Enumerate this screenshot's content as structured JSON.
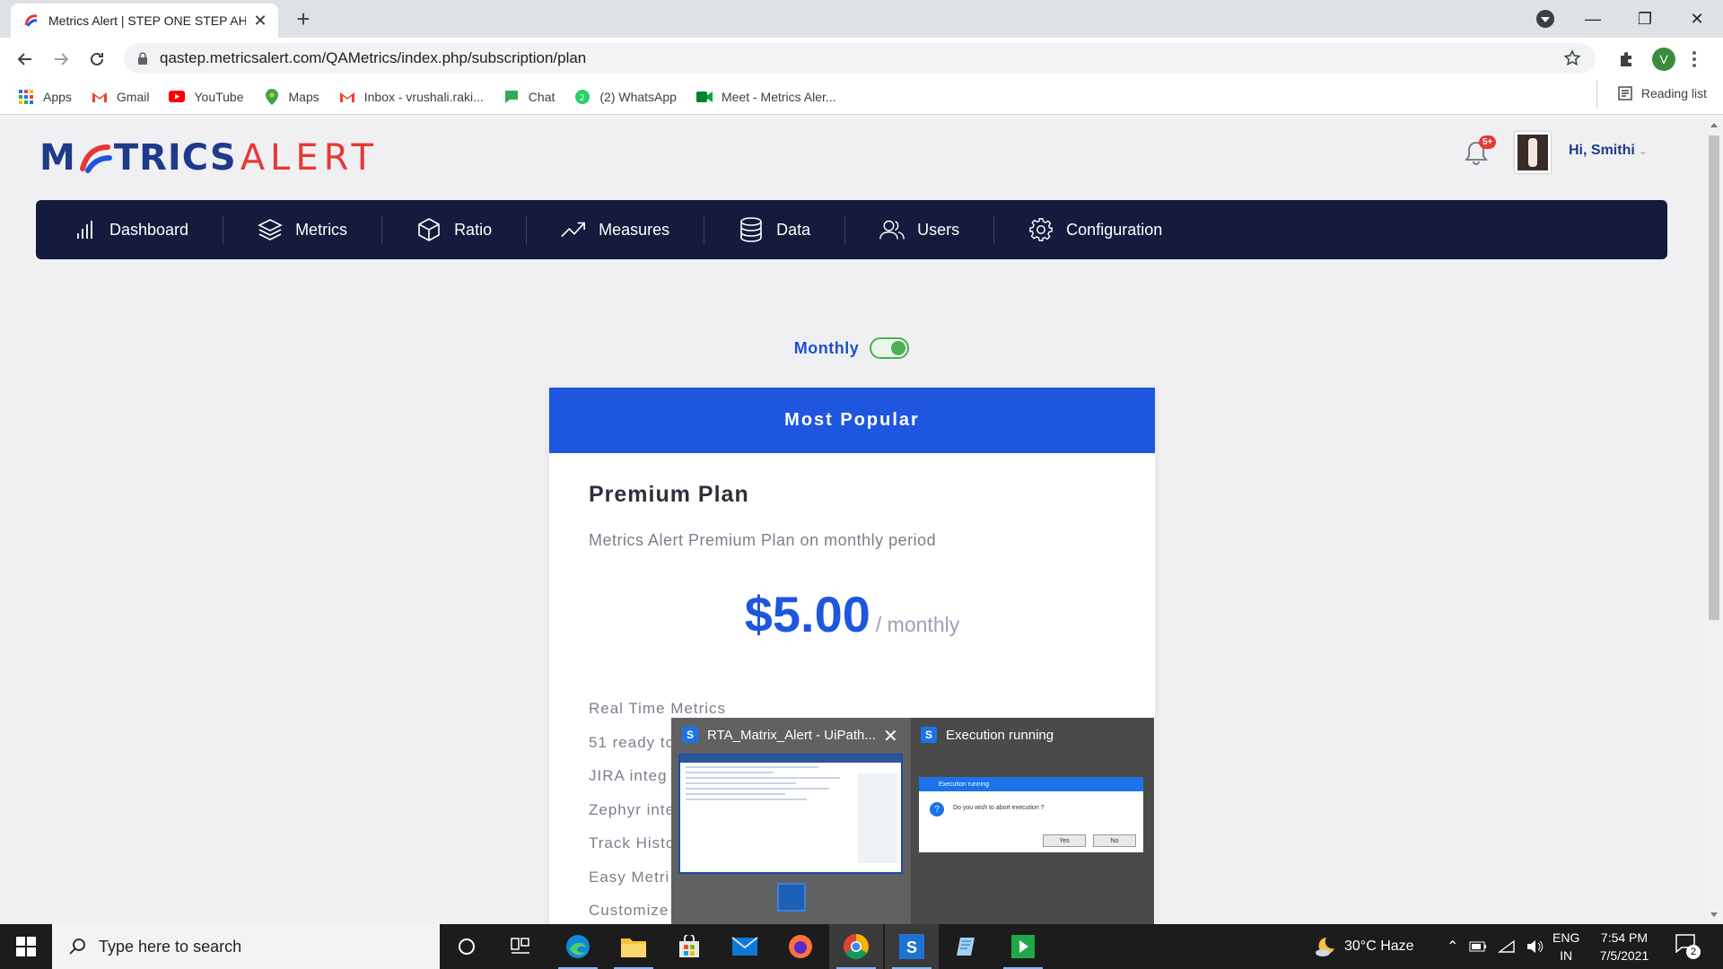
{
  "browser": {
    "tab_title": "Metrics Alert | STEP ONE STEP AH",
    "new_tab_label": "+",
    "url": "qastep.metricsalert.com/QAMetrics/index.php/subscription/plan",
    "profile_initial": "V",
    "bookmarks": [
      {
        "label": "Apps",
        "icon": "apps-grid-icon"
      },
      {
        "label": "Gmail",
        "icon": "gmail-icon"
      },
      {
        "label": "YouTube",
        "icon": "youtube-icon"
      },
      {
        "label": "Maps",
        "icon": "maps-icon"
      },
      {
        "label": "Inbox - vrushali.raki...",
        "icon": "gmail-icon"
      },
      {
        "label": "Chat",
        "icon": "chat-icon"
      },
      {
        "label": "(2) WhatsApp",
        "icon": "whatsapp-icon"
      },
      {
        "label": "Meet - Metrics Aler...",
        "icon": "meet-icon"
      }
    ],
    "reading_list": "Reading list"
  },
  "site": {
    "logo_part1": "M",
    "logo_part2": "TRICS",
    "logo_part3": "ALERT",
    "notification_badge": "5+",
    "greeting": "Hi, Smithi",
    "nav": [
      {
        "label": "Dashboard",
        "icon": "bar-chart-icon"
      },
      {
        "label": "Metrics",
        "icon": "layers-icon"
      },
      {
        "label": "Ratio",
        "icon": "cube-icon"
      },
      {
        "label": "Measures",
        "icon": "trend-line-icon"
      },
      {
        "label": "Data",
        "icon": "database-icon"
      },
      {
        "label": "Users",
        "icon": "users-icon"
      },
      {
        "label": "Configuration",
        "icon": "gear-icon"
      }
    ],
    "billing_label": "Monthly",
    "billing_toggle_on": true,
    "plan": {
      "banner": "Most Popular",
      "name": "Premium Plan",
      "description": "Metrics Alert Premium Plan on monthly period",
      "price": "$5.00",
      "period": "/ monthly",
      "features": [
        "Real Time Metrics",
        "51 ready to",
        "JIRA integ",
        "Zephyr inte",
        "Track Histo",
        "Easy Metri",
        "Customize"
      ]
    }
  },
  "taskview": {
    "window1_title": "RTA_Matrix_Alert - UiPath...",
    "window2_title": "Execution running",
    "dialog_title": "Execution running",
    "dialog_message": "Do you wish to abort execution ?",
    "dialog_yes": "Yes",
    "dialog_no": "No"
  },
  "taskbar": {
    "search_placeholder": "Type here to search",
    "weather": "30°C  Haze",
    "lang_line1": "ENG",
    "lang_line2": "IN",
    "time": "7:54 PM",
    "date": "7/5/2021",
    "notification_count": "2"
  },
  "colors": {
    "nav_bg": "#141b3d",
    "accent_blue": "#1f56e0",
    "logo_red": "#e53935",
    "toggle_green": "#4caf50"
  }
}
